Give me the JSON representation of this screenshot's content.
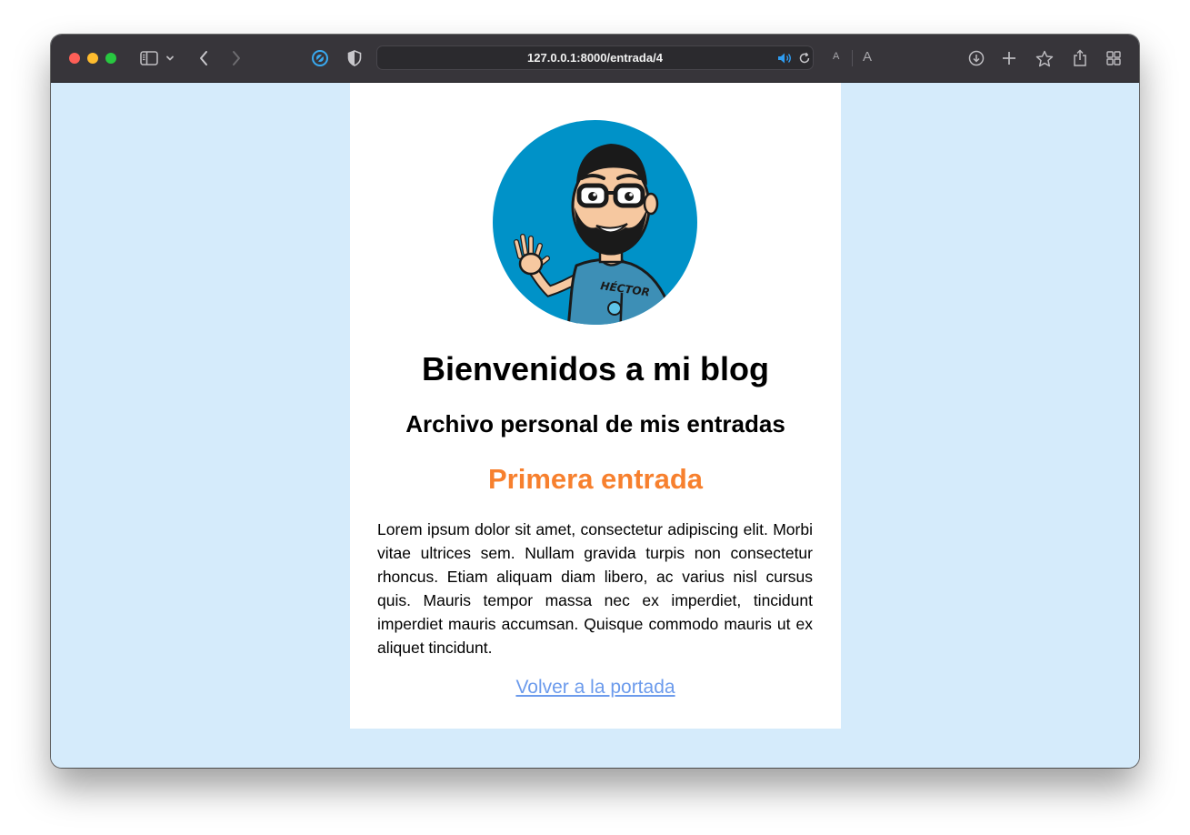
{
  "browser": {
    "url": "127.0.0.1:8000/entrada/4",
    "text_size_small": "A",
    "text_size_large": "A",
    "toolbar_icons": [
      "sidebar-icon",
      "chevron-down-icon",
      "back-icon",
      "forward-icon",
      "extension-icon",
      "shield-icon",
      "speaker-icon",
      "reload-icon",
      "download-icon",
      "new-tab-icon",
      "bookmark-star-icon",
      "share-icon",
      "tab-overview-icon"
    ],
    "colors": {
      "toolbar": "#37353a",
      "traffic_red": "#fe5f57",
      "traffic_yellow": "#febc2e",
      "traffic_green": "#28c840"
    }
  },
  "page": {
    "background_color": "#d5ebfb",
    "avatar": {
      "icon": "cartoon-avatar-waving",
      "circle_color": "#0092c8",
      "shirt_lettering": "HÉCTOR"
    },
    "title": "Bienvenidos a mi blog",
    "subtitle": "Archivo personal de mis entradas",
    "entry": {
      "title": "Primera entrada",
      "title_color": "#f7802e",
      "body": "Lorem ipsum dolor sit amet, consectetur adipiscing elit. Morbi vitae ultrices sem. Nullam gravida turpis non consectetur rhoncus. Etiam aliquam diam libero, ac varius nisl cursus quis. Mauris tempor massa nec ex imperdiet, tincidunt imperdiet mauris accumsan. Quisque commodo mauris ut ex aliquet tincidunt."
    },
    "back_link": {
      "label": "Volver a la portada",
      "color": "#6c9bec"
    }
  }
}
